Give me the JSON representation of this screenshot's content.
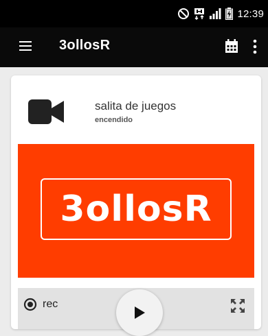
{
  "status_bar": {
    "time": "12:39",
    "icons": [
      "do-not-disturb-icon",
      "data-transfer-icon",
      "signal-icon",
      "battery-charging-icon"
    ]
  },
  "app_bar": {
    "title": "3ollosR",
    "icons": [
      "menu-icon",
      "calendar-icon",
      "more-vert-icon"
    ]
  },
  "camera_card": {
    "name": "salita de juegos",
    "status": "encendido",
    "preview_logo": "3ollosR",
    "preview_color": "#ff3d00",
    "controls": {
      "rec_label": "rec",
      "icons": [
        "record-icon",
        "play-icon",
        "fullscreen-icon"
      ]
    }
  }
}
